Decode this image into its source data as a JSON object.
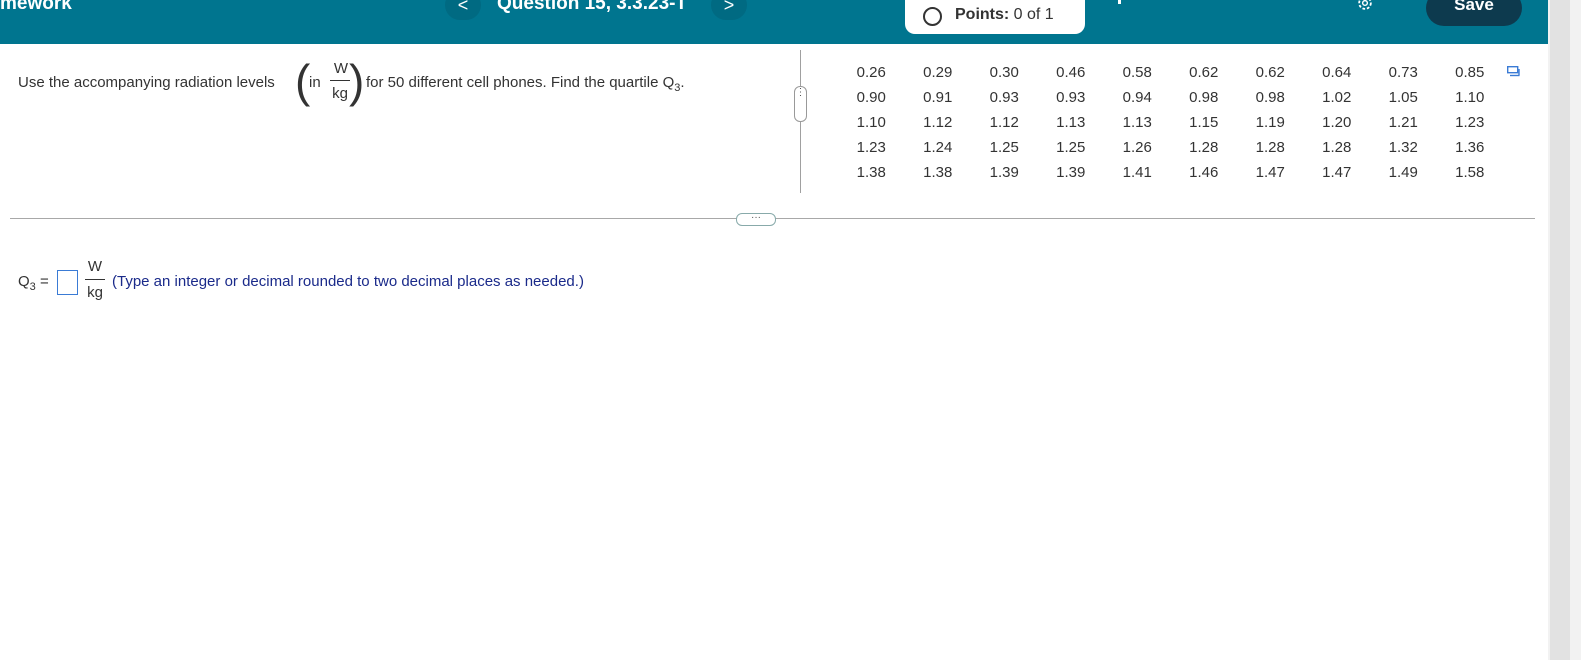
{
  "header": {
    "app_title": "mework",
    "prev_label": "<",
    "next_label": ">",
    "question_title": "Question 15, 3.3.23-T",
    "points_prefix": "Points:",
    "points_value": "0 of 1",
    "save_label": "Save"
  },
  "question": {
    "prefix": "Use the accompanying radiation levels",
    "unit_in": "in",
    "unit_num": "W",
    "unit_den": "kg",
    "suffix": "for 50 different cell phones. Find the quartile Q",
    "suffix_sub": "3",
    "suffix_end": "."
  },
  "data_table": {
    "rows": [
      [
        "0.26",
        "0.29",
        "0.30",
        "0.46",
        "0.58",
        "0.62",
        "0.62",
        "0.64",
        "0.73",
        "0.85"
      ],
      [
        "0.90",
        "0.91",
        "0.93",
        "0.93",
        "0.94",
        "0.98",
        "0.98",
        "1.02",
        "1.05",
        "1.10"
      ],
      [
        "1.10",
        "1.12",
        "1.12",
        "1.13",
        "1.13",
        "1.15",
        "1.19",
        "1.20",
        "1.21",
        "1.23"
      ],
      [
        "1.23",
        "1.24",
        "1.25",
        "1.25",
        "1.26",
        "1.28",
        "1.28",
        "1.28",
        "1.32",
        "1.36"
      ],
      [
        "1.38",
        "1.38",
        "1.39",
        "1.39",
        "1.41",
        "1.46",
        "1.47",
        "1.47",
        "1.49",
        "1.58"
      ]
    ]
  },
  "answer": {
    "label": "Q",
    "label_sub": "3",
    "equals": "=",
    "unit_num": "W",
    "unit_den": "kg",
    "hint": "(Type an integer or decimal rounded to two decimal places as needed.)"
  },
  "icons": {
    "settings": "gear-icon",
    "copy": "copy-icon",
    "splitter_v": "vertical-ellipsis-icon",
    "splitter_h": "horizontal-ellipsis-icon"
  }
}
